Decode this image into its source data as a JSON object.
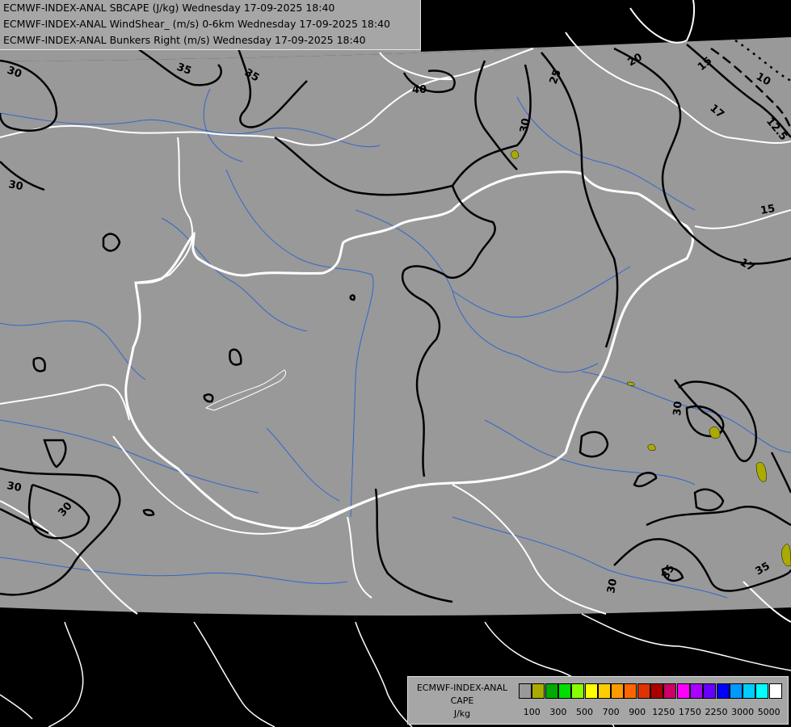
{
  "header": {
    "line1": "ECMWF-INDEX-ANAL SBCAPE (J/kg) Wednesday 17-09-2025 18:40",
    "line2": "ECMWF-INDEX-ANAL WindShear_ (m/s) 0-6km Wednesday 17-09-2025 18:40",
    "line3": "ECMWF-INDEX-ANAL Bunkers Right (m/s) Wednesday 17-09-2025 18:40"
  },
  "contour_labels": [
    "30",
    "35",
    "35",
    "40",
    "25",
    "20",
    "15",
    "17",
    "10",
    "12.5",
    "30",
    "15",
    "17",
    "30",
    "30",
    "30",
    "35",
    "35",
    "30"
  ],
  "legend": {
    "title_line1": "ECMWF-INDEX-ANAL",
    "title_line2": "CAPE",
    "title_line3": "J/kg",
    "colors": [
      "#999999",
      "#aaaa00",
      "#00aa00",
      "#00dd00",
      "#88ff00",
      "#ffff00",
      "#ffcc00",
      "#ff9900",
      "#ff6600",
      "#dd3300",
      "#aa0000",
      "#cc0066",
      "#ff00ff",
      "#aa00ff",
      "#6600ff",
      "#0000ff",
      "#0099ff",
      "#00ccff",
      "#00ffff",
      "#ffffff"
    ],
    "ticks": [
      "100",
      "300",
      "500",
      "700",
      "900",
      "1250",
      "1750",
      "2250",
      "3000",
      "5000"
    ]
  },
  "colors": {
    "ocean": "#000000",
    "land": "#999999",
    "borders": "#ffffff",
    "rivers": "#3366cc",
    "cape_low": "#aaaa00"
  }
}
